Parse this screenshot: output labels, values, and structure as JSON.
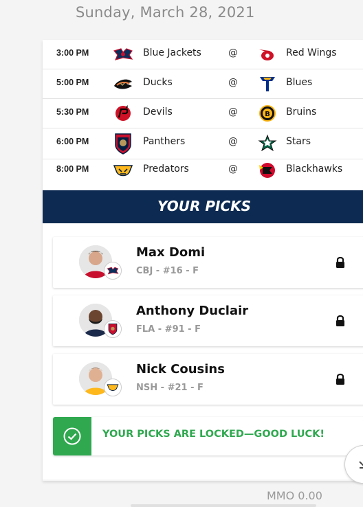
{
  "date_header": "Sunday, March 28, 2021",
  "games": [
    {
      "time": "3:00 PM",
      "away": "Blue Jackets",
      "away_icon": "blue-jackets-logo",
      "at": "@",
      "home": "Red Wings",
      "home_icon": "red-wings-logo"
    },
    {
      "time": "5:00 PM",
      "away": "Ducks",
      "away_icon": "ducks-logo",
      "at": "@",
      "home": "Blues",
      "home_icon": "blues-logo"
    },
    {
      "time": "5:30 PM",
      "away": "Devils",
      "away_icon": "devils-logo",
      "at": "@",
      "home": "Bruins",
      "home_icon": "bruins-logo"
    },
    {
      "time": "6:00 PM",
      "away": "Panthers",
      "away_icon": "panthers-logo",
      "at": "@",
      "home": "Stars",
      "home_icon": "stars-logo"
    },
    {
      "time": "8:00 PM",
      "away": "Predators",
      "away_icon": "predators-logo",
      "at": "@",
      "home": "Blackhawks",
      "home_icon": "blackhawks-logo"
    }
  ],
  "picks_header": "YOUR PICKS",
  "picks": [
    {
      "name": "Max Domi",
      "meta": "CBJ - #16 - F",
      "team_icon": "blue-jackets-logo",
      "lock_icon": "lock-icon"
    },
    {
      "name": "Anthony Duclair",
      "meta": "FLA - #91 - F",
      "team_icon": "panthers-logo",
      "lock_icon": "lock-icon"
    },
    {
      "name": "Nick Cousins",
      "meta": "NSH - #21 - F",
      "team_icon": "predators-logo",
      "lock_icon": "lock-icon"
    }
  ],
  "locked_message": "YOUR PICKS ARE LOCKED—GOOD LUCK!",
  "bottom_partial_text": "MMO 0.00",
  "colors": {
    "header_navy": "#0d2b52",
    "success_green": "#2fa84f",
    "muted_text": "#999999"
  }
}
